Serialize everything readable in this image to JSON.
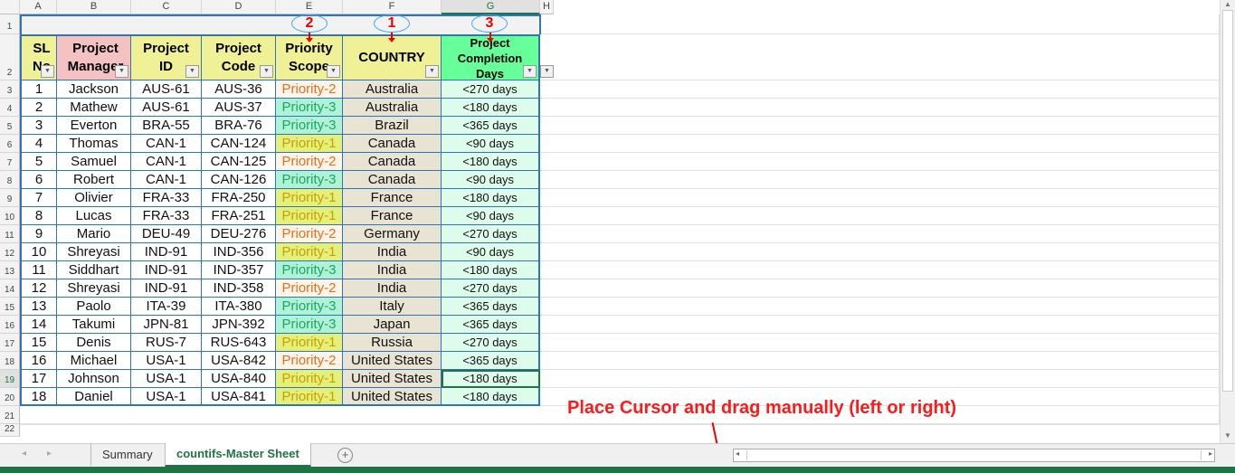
{
  "columns": [
    "A",
    "B",
    "C",
    "D",
    "E",
    "F",
    "G",
    "H"
  ],
  "row_numbers": [
    "1",
    "2",
    "3",
    "4",
    "5",
    "6",
    "7",
    "8",
    "9",
    "10",
    "11",
    "12",
    "13",
    "14",
    "15",
    "16",
    "17",
    "18",
    "19",
    "20",
    "21",
    "22"
  ],
  "headers": [
    "SL No",
    "Project Manager",
    "Project ID",
    "Project Code",
    "Priority Scope",
    "COUNTRY",
    "Project Completion Days"
  ],
  "header_display": [
    "SL\nN",
    "Project\nManage",
    "Project\nID",
    "Project\nCode",
    "Priority\nScope",
    "COUNTRY",
    "Project\nCompletion\nDays"
  ],
  "annotations": {
    "ovals": [
      "2",
      "1",
      "3"
    ],
    "instruction": "Place Cursor and drag manually (left or right)"
  },
  "rows": [
    [
      "1",
      "Jackson",
      "AUS-61",
      "AUS-36",
      "Priority-2",
      "Australia",
      "<270 days"
    ],
    [
      "2",
      "Mathew",
      "AUS-61",
      "AUS-37",
      "Priority-3",
      "Australia",
      "<180 days"
    ],
    [
      "3",
      "Everton",
      "BRA-55",
      "BRA-76",
      "Priority-3",
      "Brazil",
      "<365 days"
    ],
    [
      "4",
      "Thomas",
      "CAN-1",
      "CAN-124",
      "Priority-1",
      "Canada",
      "<90 days"
    ],
    [
      "5",
      "Samuel",
      "CAN-1",
      "CAN-125",
      "Priority-2",
      "Canada",
      "<180 days"
    ],
    [
      "6",
      "Robert",
      "CAN-1",
      "CAN-126",
      "Priority-3",
      "Canada",
      "<90 days"
    ],
    [
      "7",
      "Olivier",
      "FRA-33",
      "FRA-250",
      "Priority-1",
      "France",
      "<180 days"
    ],
    [
      "8",
      "Lucas",
      "FRA-33",
      "FRA-251",
      "Priority-1",
      "France",
      "<90 days"
    ],
    [
      "9",
      "Mario",
      "DEU-49",
      "DEU-276",
      "Priority-2",
      "Germany",
      "<270 days"
    ],
    [
      "10",
      "Shreyasi",
      "IND-91",
      "IND-356",
      "Priority-1",
      "India",
      "<90 days"
    ],
    [
      "11",
      "Siddhart",
      "IND-91",
      "IND-357",
      "Priority-3",
      "India",
      "<180 days"
    ],
    [
      "12",
      "Shreyasi",
      "IND-91",
      "IND-358",
      "Priority-2",
      "India",
      "<270 days"
    ],
    [
      "13",
      "Paolo",
      "ITA-39",
      "ITA-380",
      "Priority-3",
      "Italy",
      "<365 days"
    ],
    [
      "14",
      "Takumi",
      "JPN-81",
      "JPN-392",
      "Priority-3",
      "Japan",
      "<365 days"
    ],
    [
      "15",
      "Denis",
      "RUS-7",
      "RUS-643",
      "Priority-1",
      "Russia",
      "<270 days"
    ],
    [
      "16",
      "Michael",
      "USA-1",
      "USA-842",
      "Priority-2",
      "United States",
      "<365 days"
    ],
    [
      "17",
      "Johnson",
      "USA-1",
      "USA-840",
      "Priority-1",
      "United States",
      "<180 days"
    ],
    [
      "18",
      "Daniel",
      "USA-1",
      "USA-841",
      "Priority-1",
      "United States",
      "<180 days"
    ]
  ],
  "tabs": [
    {
      "label": "Summary",
      "active": false
    },
    {
      "label": "countifs-Master Sheet",
      "active": true
    }
  ],
  "colors": {
    "accent": "#217346",
    "header_yellow": "#f0f096",
    "header_pink": "#f4c2c2",
    "header_green": "#66ff99",
    "country_bg": "#e8e3d3",
    "days_bg": "#ddfcec",
    "p1_bg": "#e4f07a",
    "p1_text": "#c8a000",
    "p2_bg": "#fff4e8",
    "p2_text": "#e07020",
    "p3_bg": "#b0f2d8",
    "p3_text": "#1aa860"
  }
}
